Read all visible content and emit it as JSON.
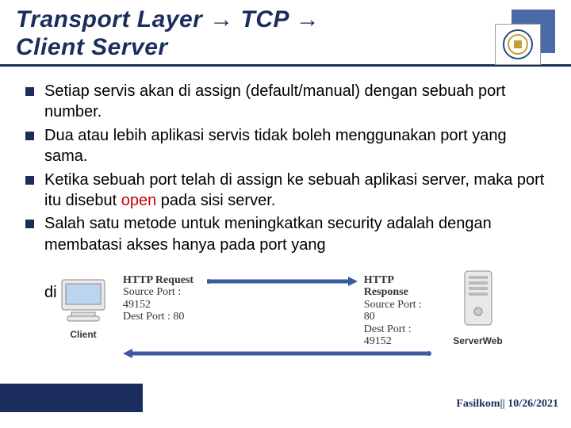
{
  "header": {
    "title_line1": "Transport Layer → TCP →",
    "title_line2": "Client Server"
  },
  "bullets": [
    "Setiap servis akan di assign (default/manual) dengan sebuah port number.",
    "Dua atau lebih aplikasi servis tidak boleh menggunakan port yang sama.",
    "Ketika sebuah port telah di assign ke sebuah aplikasi server, maka port itu disebut ",
    "Salah satu metode untuk meningkatkan security adalah dengan membatasi akses hanya pada port yang"
  ],
  "open_word": "open",
  "after_open": " pada sisi server.",
  "di_text": "di",
  "diagram": {
    "client_label": "Client",
    "server_label": "ServerWeb",
    "request": {
      "heading": "HTTP Request",
      "src": "Source Port : 49152",
      "dst": "Dest Port : 80"
    },
    "response": {
      "heading": "HTTP Response",
      "src": "Source Port : 80",
      "dst": "Dest Port : 49152"
    }
  },
  "footer": "Fasilkom|| 10/26/2021"
}
